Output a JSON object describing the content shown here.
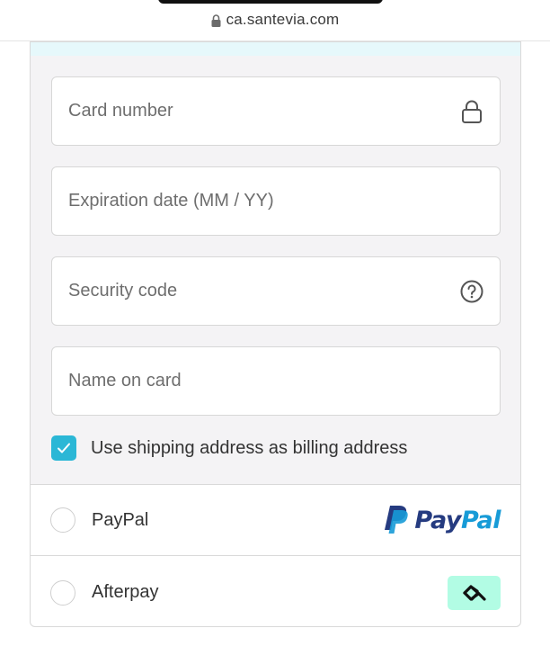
{
  "browser": {
    "url": "ca.santevia.com",
    "icons": {
      "secure": "lock-icon"
    }
  },
  "card_form": {
    "fields": [
      {
        "placeholder": "Card number",
        "icon": "lock-icon"
      },
      {
        "placeholder": "Expiration date (MM / YY)"
      },
      {
        "placeholder": "Security code",
        "icon": "help-circle-icon"
      },
      {
        "placeholder": "Name on card"
      }
    ],
    "billing_checkbox": {
      "label": "Use shipping address as billing address",
      "checked": true
    }
  },
  "payment_options": [
    {
      "label": "PayPal",
      "logo": "paypal-logo",
      "logo_text_pay": "Pay",
      "logo_text_pal": "Pal"
    },
    {
      "label": "Afterpay",
      "logo": "afterpay-logo"
    }
  ],
  "colors": {
    "accent": "#2bb7d6",
    "banner_border": "#25c2d4",
    "paypal_dark": "#253b80",
    "paypal_light": "#179bd7",
    "afterpay_mint": "#b2fce4"
  }
}
